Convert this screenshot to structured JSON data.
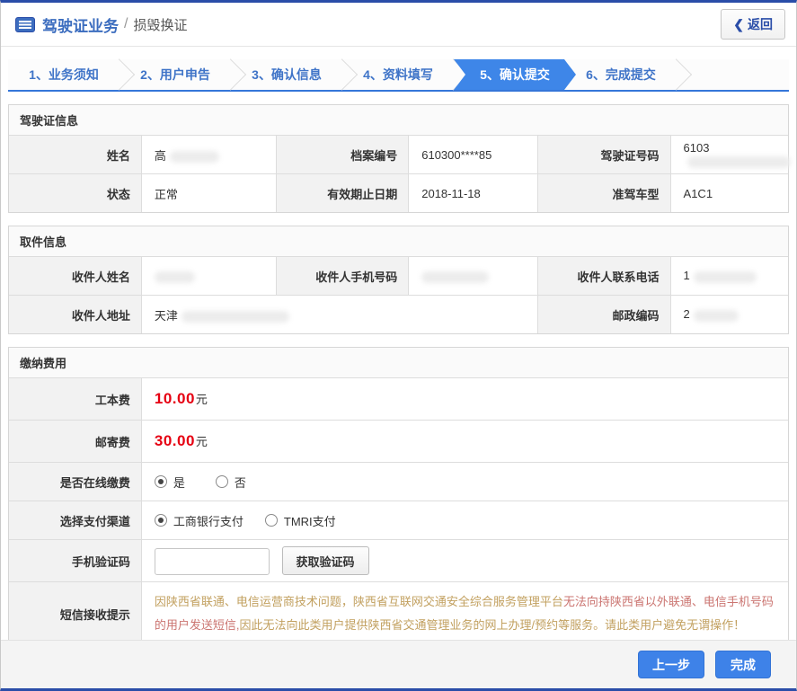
{
  "header": {
    "title": "驾驶证业务",
    "divider": "/",
    "subtitle": "损毁换证",
    "back_chevron": "❮",
    "back_button": "返回"
  },
  "steps": {
    "items": [
      {
        "label": "1、业务须知",
        "active": false
      },
      {
        "label": "2、用户申告",
        "active": false
      },
      {
        "label": "3、确认信息",
        "active": false
      },
      {
        "label": "4、资料填写",
        "active": false
      },
      {
        "label": "5、确认提交",
        "active": true
      },
      {
        "label": "6、完成提交",
        "active": false
      }
    ]
  },
  "license_section": {
    "title": "驾驶证信息",
    "fields": {
      "name": {
        "label": "姓名",
        "value": "高",
        "masked": true
      },
      "file_no": {
        "label": "档案编号",
        "value": "610300****85",
        "masked": false
      },
      "license_no": {
        "label": "驾驶证号码",
        "value": "6103",
        "masked": true
      },
      "status": {
        "label": "状态",
        "value": "正常",
        "masked": false
      },
      "expiry": {
        "label": "有效期止日期",
        "value": "2018-11-18",
        "masked": false
      },
      "vehicle_class": {
        "label": "准驾车型",
        "value": "A1C1",
        "masked": false
      }
    }
  },
  "pickup_section": {
    "title": "取件信息",
    "fields": {
      "recipient_name": {
        "label": "收件人姓名",
        "value": "",
        "masked": true
      },
      "recipient_mobile": {
        "label": "收件人手机号码",
        "value": "",
        "masked": true
      },
      "recipient_phone": {
        "label": "收件人联系电话",
        "value": "1",
        "masked": true
      },
      "recipient_address": {
        "label": "收件人地址",
        "value": "天津",
        "masked": true
      },
      "postal_code": {
        "label": "邮政编码",
        "value": "2",
        "masked": true
      }
    }
  },
  "fees_section": {
    "title": "缴纳费用",
    "production_fee": {
      "label": "工本费",
      "amount": "10.00",
      "unit": "元"
    },
    "mailing_fee": {
      "label": "邮寄费",
      "amount": "30.00",
      "unit": "元"
    },
    "online_payment": {
      "label": "是否在线缴费",
      "options": [
        {
          "label": "是",
          "selected": true
        },
        {
          "label": "否",
          "selected": false
        }
      ]
    },
    "payment_channel": {
      "label": "选择支付渠道",
      "options": [
        {
          "label": "工商银行支付",
          "selected": true
        },
        {
          "label": "TMRI支付",
          "selected": false
        }
      ]
    },
    "verification": {
      "label": "手机验证码",
      "input_value": "",
      "button_label": "获取验证码"
    },
    "sms_notice": {
      "label": "短信接收提示",
      "text_part1": "因陕西省联通、电信运营商技术问题，陕西省互联网交通安全综合服务管理平台",
      "text_part2": "无法向持陕西省以外联通、电信手机号码的用户发送短信,",
      "text_part3": "因此无法向此类用户提供陕西省交通管理业务的网上办理/预约等服务。请此类用户避免无谓操作！"
    }
  },
  "footer": {
    "prev_button": "上一步",
    "finish_button": "完成"
  },
  "colors": {
    "top_bar_blue": "#2a4da8",
    "accent_blue": "#3c6dbf",
    "active_step_blue": "#3e86e8",
    "button_blue": "#3e82e8",
    "price_red": "#e60012",
    "notice_tan": "#c2a05f",
    "notice_red": "#cb7571",
    "label_cell_gray": "#f2f2f2"
  }
}
